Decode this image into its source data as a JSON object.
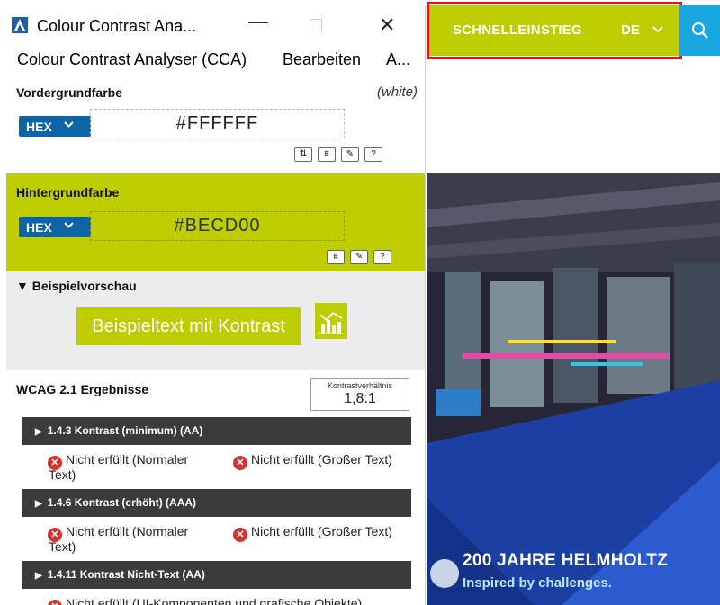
{
  "site": {
    "quickstart": "SCHNELLEINSTIEG",
    "language": "DE",
    "hero_title": "200 JAHRE HELMHOLTZ",
    "hero_subtitle": "Inspired by challenges.",
    "colors": {
      "bar": "#becd00",
      "search": "#18a7e0",
      "highlight": "#e4151a"
    }
  },
  "window": {
    "title": "Colour Contrast Ana...",
    "menu": [
      "Colour Contrast Analyser (CCA)",
      "Bearbeiten",
      "A..."
    ]
  },
  "foreground": {
    "label": "Vordergrundfarbe",
    "name": "(white)",
    "format": "HEX",
    "value": "#FFFFFF"
  },
  "background": {
    "label": "Hintergrundfarbe",
    "format": "HEX",
    "value": "#BECD00"
  },
  "preview": {
    "title": "▼ Beispielvorschau",
    "sample_text": "Beispieltext mit Kontrast"
  },
  "results": {
    "title": "WCAG 2.1 Ergebnisse",
    "ratio_label": "Kontrastverhältnis",
    "ratio_value": "1,8:1",
    "criteria": [
      {
        "label": "1.4.3 Kontrast (minimum) (AA)",
        "normal": "Nicht erfüllt (Normaler",
        "normal_cont": "Text)",
        "large": "Nicht erfüllt (Großer Text)"
      },
      {
        "label": "1.4.6 Kontrast (erhöht) (AAA)",
        "normal": "Nicht erfüllt (Normaler",
        "normal_cont": "Text)",
        "large": "Nicht erfüllt (Großer Text)"
      },
      {
        "label": "1.4.11 Kontrast Nicht-Text (AA)",
        "ui": "Nicht erfüllt (UI-Komponenten und grafische Objekte)"
      }
    ]
  }
}
